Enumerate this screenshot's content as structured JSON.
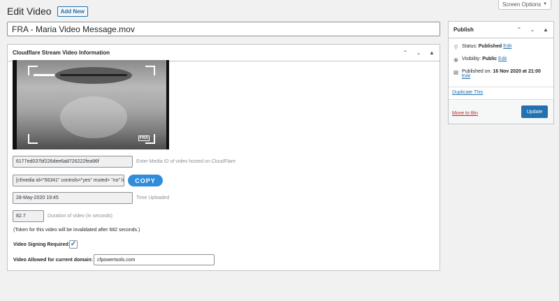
{
  "screen_options": {
    "label": "Screen Options"
  },
  "header": {
    "title": "Edit Video",
    "add_new": "Add New"
  },
  "post_title": "FRA - Maria Video Message.mov",
  "cloudflare": {
    "box_title": "Cloudflare Stream Video Information",
    "video_thumbnail": "video-frame",
    "cam_label": "FRA",
    "media_id": "6177ed037bf226dee6a8726222fea96f",
    "media_id_hint": "Enter Media ID of video hosted on CloudFlare",
    "shortcode": "[cfmedia id=\"56341\" controls=\"yes\" muted= \"no\" loop",
    "copy_label": "COPY",
    "time_uploaded": "28-May-2020 19:45",
    "time_uploaded_hint": "Time Uploaded",
    "duration": "82.7",
    "duration_hint": "Duration of video (in seconds)",
    "token_note": "(Token for this video will be invalidated after 682 seconds.)",
    "signing_label": "Video Signing Required:",
    "signing_checked": true,
    "domain_label": "Video Allowed for current domain:",
    "domain_value": "cfpowertools.com"
  },
  "publish": {
    "title": "Publish",
    "status_label": "Status:",
    "status_value": "Published",
    "status_edit": "Edit",
    "visibility_label": "Visibility:",
    "visibility_value": "Public",
    "visibility_edit": "Edit",
    "published_label": "Published on:",
    "published_value": "16 Nov 2020 at 21:00",
    "published_edit": "Edit",
    "duplicate": "Duplicate This",
    "move_to_bin": "Move to Bin",
    "update": "Update"
  },
  "colors": {
    "accent": "#2271b1",
    "copy_button": "#2f8ddb",
    "trash": "#b32d2e"
  }
}
